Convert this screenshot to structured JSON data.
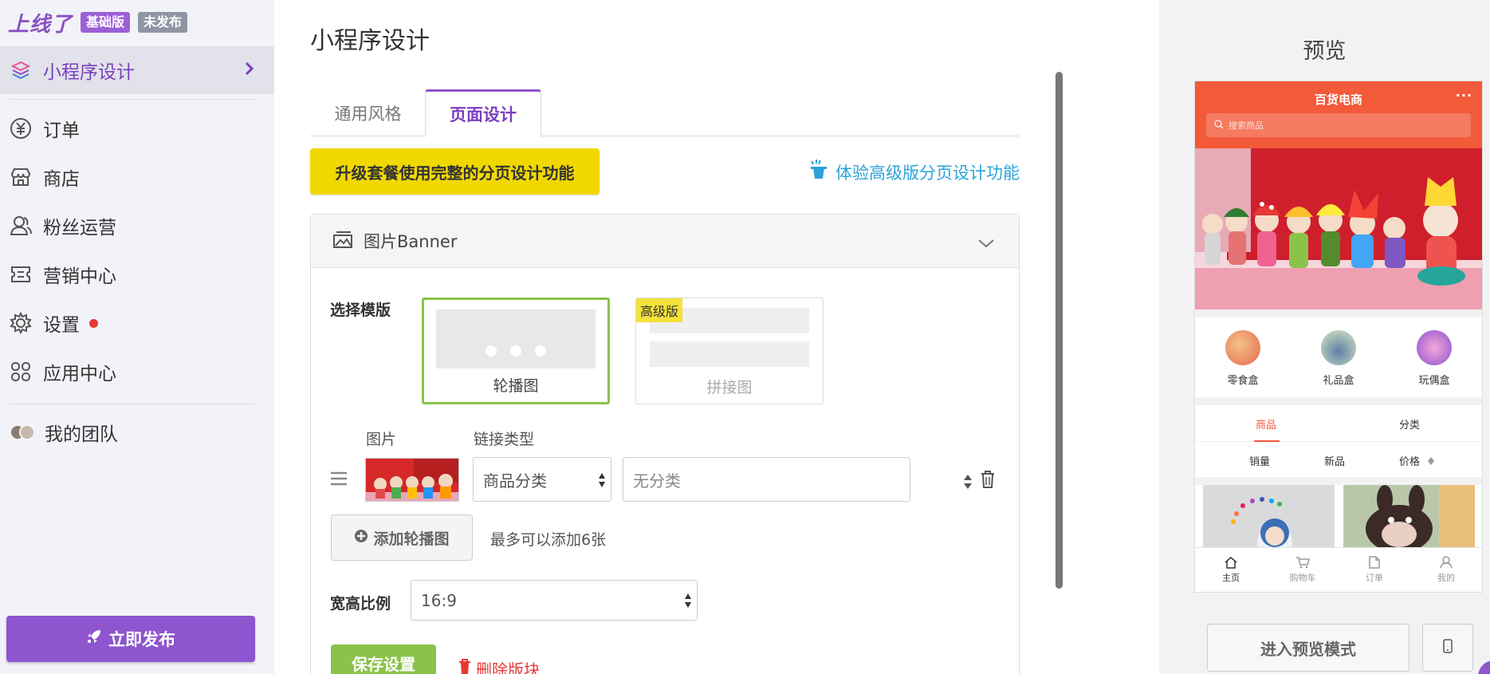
{
  "brand": {
    "logo": "上线了",
    "plan_badge": "基础版",
    "status_badge": "未发布"
  },
  "sidebar": {
    "items": [
      {
        "label": "小程序设计",
        "icon": "layers-icon",
        "active": true
      },
      {
        "label": "订单",
        "icon": "yen-icon"
      },
      {
        "label": "商店",
        "icon": "store-icon"
      },
      {
        "label": "粉丝运营",
        "icon": "fans-icon"
      },
      {
        "label": "营销中心",
        "icon": "ticket-icon"
      },
      {
        "label": "设置",
        "icon": "gear-icon",
        "has_alert_dot": true
      },
      {
        "label": "应用中心",
        "icon": "apps-icon"
      },
      {
        "label": "我的团队",
        "icon": "team-avatar"
      }
    ],
    "publish_label": "立即发布"
  },
  "main": {
    "title": "小程序设计",
    "tabs": [
      {
        "label": "通用风格"
      },
      {
        "label": "页面设计",
        "active": true
      }
    ],
    "upgrade_label": "升级套餐使用完整的分页设计功能",
    "trial_link": "体验高级版分页设计功能",
    "panel": {
      "header": "图片Banner",
      "template_label": "选择模版",
      "templates": [
        {
          "name": "轮播图",
          "selected": true
        },
        {
          "name": "拼接图",
          "tag": "高级版"
        }
      ],
      "col_image": "图片",
      "col_link_type": "链接类型",
      "row": {
        "link_type": "商品分类",
        "link_value": "无分类"
      },
      "add_label": "添加轮播图",
      "add_hint": "最多可以添加6张",
      "ratio_label": "宽高比例",
      "ratio_value": "16:9",
      "save_label": "保存设置",
      "delete_label": "删除版块"
    }
  },
  "preview": {
    "title": "预览",
    "phone": {
      "shop_name": "百货电商",
      "more": "···",
      "search_placeholder": "搜索商品",
      "categories": [
        {
          "name": "零食盒"
        },
        {
          "name": "礼品盒"
        },
        {
          "name": "玩偶盒"
        }
      ],
      "tabs": [
        "商品",
        "分类"
      ],
      "sort": [
        "销量",
        "新品",
        "价格"
      ],
      "bottom_nav": [
        "主页",
        "购物车",
        "订单",
        "我的"
      ]
    },
    "enter_label": "进入预览模式"
  },
  "colors": {
    "accent": "#8e55cf",
    "upgrade": "#f0d800",
    "save": "#8bc34a",
    "phone_header": "#f25a3a",
    "link": "#2ba3d9",
    "danger": "#e53935"
  }
}
